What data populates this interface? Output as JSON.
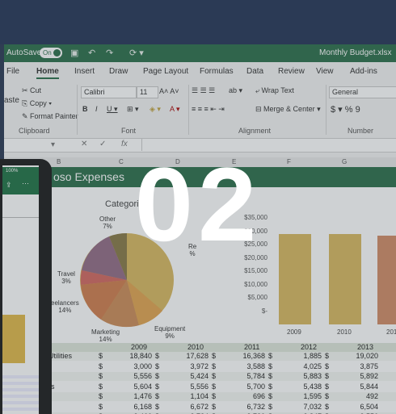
{
  "titlebar": {
    "autosave": "AutoSave",
    "toggle": "On",
    "filename": "Monthly Budget.xlsx"
  },
  "tabs": [
    "File",
    "Home",
    "Insert",
    "Draw",
    "Page Layout",
    "Formulas",
    "Data",
    "Review",
    "View",
    "Add-ins"
  ],
  "ribbon": {
    "paste": "aste",
    "cut": "Cut",
    "copy": "Copy",
    "format_painter": "Format Painter",
    "font_name": "Calibri",
    "font_size": "11",
    "wrap_text": "Wrap Text",
    "merge_center": "Merge & Center",
    "number_format": "General",
    "groups": {
      "clipboard": "Clipboard",
      "font": "Font",
      "alignment": "Alignment",
      "number": "Number"
    }
  },
  "formula_bar": {
    "fx": "fx"
  },
  "columns": [
    "B",
    "C",
    "D",
    "E",
    "F",
    "G"
  ],
  "sheet": {
    "banner_title": "oso Expenses",
    "pie_title": "Categories",
    "pie_labels": [
      {
        "name": "Other",
        "value": "7%"
      },
      {
        "name": "Travel",
        "value": "3%"
      },
      {
        "name": "eelancers",
        "value": "14%"
      },
      {
        "name": "Marketing",
        "value": "14%"
      },
      {
        "name": "Equipment",
        "value": "9%"
      },
      {
        "name": "Re",
        "value": "%"
      }
    ],
    "bar_axis": [
      "$35,000",
      "$30,000",
      "$25,000",
      "$20,000",
      "$15,000",
      "$10,000",
      "$5,000",
      "$-"
    ],
    "bar_years": [
      "2009",
      "2010",
      "201"
    ]
  },
  "table": {
    "years": [
      "2009",
      "2010",
      "2011",
      "2012",
      "2013"
    ],
    "rows": [
      {
        "label": "Utilities",
        "values": [
          "18,840",
          "17,628",
          "16,368",
          "1,885",
          "19,020"
        ]
      },
      {
        "label": "t",
        "values": [
          "3,000",
          "3,972",
          "3,588",
          "4,025",
          "3,875"
        ]
      },
      {
        "label": "",
        "values": [
          "5,556",
          "5,424",
          "5,784",
          "5,883",
          "5,892"
        ]
      },
      {
        "label": "rs",
        "values": [
          "5,604",
          "5,556",
          "5,700",
          "5,438",
          "5,844"
        ]
      },
      {
        "label": "",
        "values": [
          "1,476",
          "1,104",
          "696",
          "1,595",
          "492"
        ]
      },
      {
        "label": "",
        "values": [
          "6,168",
          "6,672",
          "6,732",
          "7,032",
          "6,504"
        ]
      },
      {
        "label": "",
        "values": [
          "2,460",
          "2,724",
          "3,720",
          "2,847",
          "2,556"
        ]
      }
    ],
    "currency": "$"
  },
  "phone": {
    "status": "100%"
  },
  "overlay_number": "02",
  "colors": {
    "excel_green": "#217346",
    "navy": "#2b3a55",
    "bar_gold": "#e0b84a"
  }
}
